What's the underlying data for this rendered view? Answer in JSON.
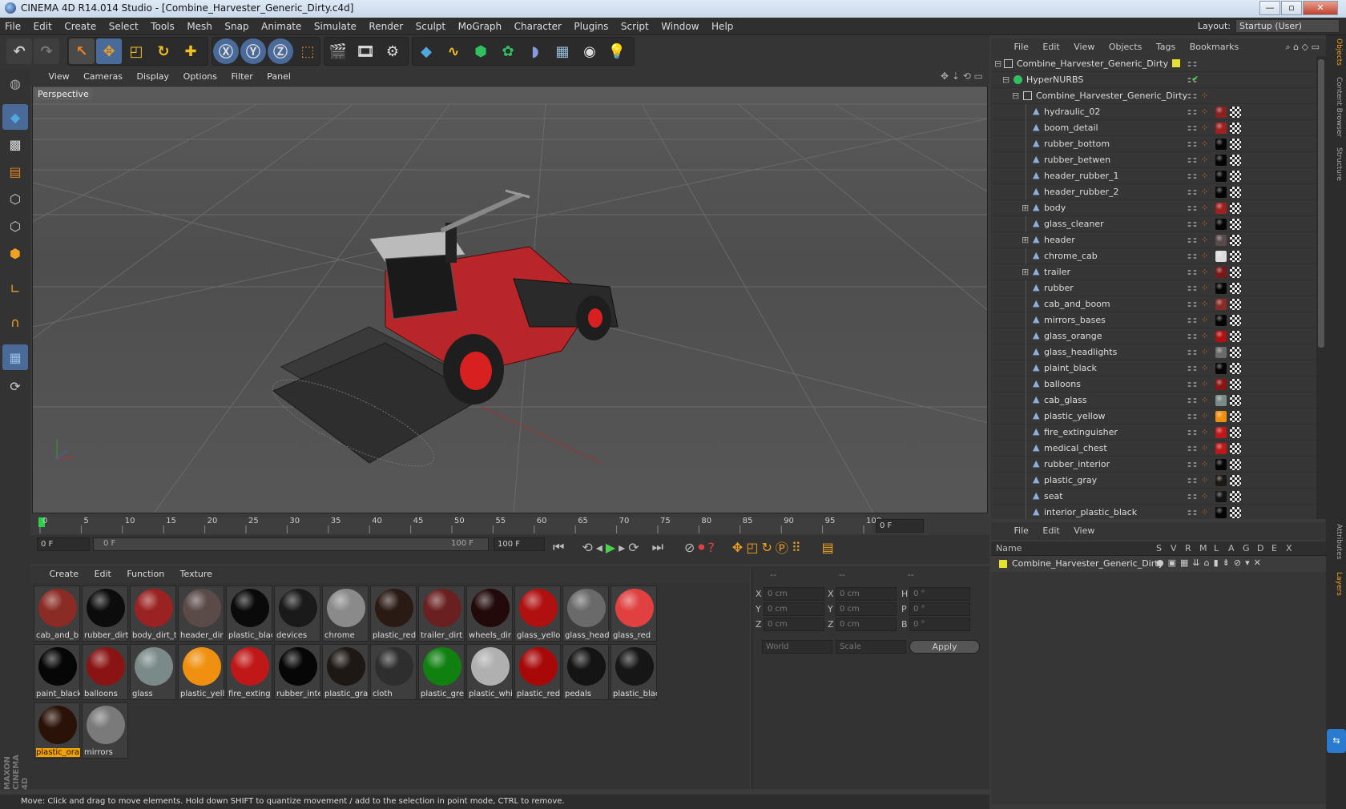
{
  "window": {
    "title": "CINEMA 4D R14.014 Studio - [Combine_Harvester_Generic_Dirty.c4d]",
    "controls": [
      "—",
      "▫",
      "✕"
    ]
  },
  "menubar": [
    "File",
    "Edit",
    "Create",
    "Select",
    "Tools",
    "Mesh",
    "Snap",
    "Animate",
    "Simulate",
    "Render",
    "Sculpt",
    "MoGraph",
    "Character",
    "Plugins",
    "Script",
    "Window",
    "Help"
  ],
  "layout": {
    "label": "Layout:",
    "value": "Startup (User)"
  },
  "viewport": {
    "menu": [
      "View",
      "Cameras",
      "Display",
      "Options",
      "Filter",
      "Panel"
    ],
    "label": "Perspective"
  },
  "timeline": {
    "ticks": [
      "0",
      "5",
      "10",
      "15",
      "20",
      "25",
      "30",
      "35",
      "40",
      "45",
      "50",
      "55",
      "60",
      "65",
      "70",
      "75",
      "80",
      "85",
      "90",
      "95",
      "100"
    ],
    "current_frame": "0 F"
  },
  "anim": {
    "start": "0 F",
    "range_start": "0 F",
    "range_end": "100 F",
    "end": "100 F"
  },
  "materials": {
    "menu": [
      "Create",
      "Edit",
      "Function",
      "Texture"
    ],
    "items": [
      {
        "name": "cab_and_b",
        "color": "#8a2b25"
      },
      {
        "name": "rubber_dirt",
        "color": "#0c0c0c"
      },
      {
        "name": "body_dirt_t",
        "color": "#9a2222"
      },
      {
        "name": "header_dir",
        "color": "#5a4a48"
      },
      {
        "name": "plastic_blac",
        "color": "#0a0a0a"
      },
      {
        "name": "devices",
        "color": "#1a1a1a"
      },
      {
        "name": "chrome",
        "color": "#8a8a8a"
      },
      {
        "name": "plastic_red",
        "color": "#2a1a14"
      },
      {
        "name": "trailer_dirt",
        "color": "#6a2020"
      },
      {
        "name": "wheels_dir",
        "color": "#220a0a"
      },
      {
        "name": "glass_yello",
        "color": "#b01010"
      },
      {
        "name": "glass_head",
        "color": "#6a6a6a"
      },
      {
        "name": "glass_red",
        "color": "#e04040"
      },
      {
        "name": "paint_black",
        "color": "#060606"
      },
      {
        "name": "balloons",
        "color": "#8a1414"
      },
      {
        "name": "glass",
        "color": "#7a8a88"
      },
      {
        "name": "plastic_yell",
        "color": "#f09010"
      },
      {
        "name": "fire_exting",
        "color": "#c01818"
      },
      {
        "name": "rubber_inte",
        "color": "#060606"
      },
      {
        "name": "plastic_gra",
        "color": "#1e1814"
      },
      {
        "name": "cloth",
        "color": "#2e2e2e"
      },
      {
        "name": "plastic_gre",
        "color": "#108010"
      },
      {
        "name": "plastic_whi",
        "color": "#b0b0b0"
      },
      {
        "name": "plastic_red",
        "color": "#a80808"
      },
      {
        "name": "pedals",
        "color": "#141414"
      },
      {
        "name": "plastic_blac",
        "color": "#161616"
      },
      {
        "name": "plastic_ora",
        "color": "#2a1208"
      },
      {
        "name": "mirrors",
        "color": "#7a7a7a"
      }
    ]
  },
  "coords": {
    "headers": [
      "--",
      "--",
      "--"
    ],
    "rows": [
      {
        "a": "X",
        "av": "0 cm",
        "b": "X",
        "bv": "0 cm",
        "c": "H",
        "cv": "0 °"
      },
      {
        "a": "Y",
        "av": "0 cm",
        "b": "Y",
        "bv": "0 cm",
        "c": "P",
        "cv": "0 °"
      },
      {
        "a": "Z",
        "av": "0 cm",
        "b": "Z",
        "bv": "0 cm",
        "c": "B",
        "cv": "0 °"
      }
    ],
    "world": "World",
    "scale": "Scale",
    "apply": "Apply"
  },
  "objects": {
    "menu": [
      "File",
      "Edit",
      "View",
      "Objects",
      "Tags",
      "Bookmarks"
    ],
    "root": "Combine_Harvester_Generic_Dirty",
    "hypernurbs": "HyperNURBS",
    "group": "Combine_Harvester_Generic_Dirty",
    "items": [
      {
        "name": "hydraulic_02",
        "tag": "#8a2020",
        "expand": false
      },
      {
        "name": "boom_detail",
        "tag": "#a02020",
        "expand": false
      },
      {
        "name": "rubber_bottom",
        "tag": "#050505",
        "expand": false
      },
      {
        "name": "rubber_betwen",
        "tag": "#050505",
        "expand": false
      },
      {
        "name": "header_rubber_1",
        "tag": "#050505",
        "expand": false
      },
      {
        "name": "header_rubber_2",
        "tag": "#050505",
        "expand": false
      },
      {
        "name": "body",
        "tag": "#a02020",
        "expand": true
      },
      {
        "name": "glass_cleaner",
        "tag": "#050505",
        "expand": false
      },
      {
        "name": "header",
        "tag": "#5a4a48",
        "expand": true
      },
      {
        "name": "chrome_cab",
        "tag": "#dddddd",
        "expand": false
      },
      {
        "name": "trailer",
        "tag": "#7a1818",
        "expand": true
      },
      {
        "name": "rubber",
        "tag": "#050505",
        "expand": false
      },
      {
        "name": "cab_and_boom",
        "tag": "#8a2b25",
        "expand": false
      },
      {
        "name": "mirrors_bases",
        "tag": "#050505",
        "expand": false
      },
      {
        "name": "glass_orange",
        "tag": "#b01010",
        "expand": false
      },
      {
        "name": "glass_headlights",
        "tag": "#6a6a6a",
        "expand": false
      },
      {
        "name": "plaint_black",
        "tag": "#050505",
        "expand": false
      },
      {
        "name": "balloons",
        "tag": "#8a1414",
        "expand": false
      },
      {
        "name": "cab_glass",
        "tag": "#7a8a88",
        "expand": false
      },
      {
        "name": "plastic_yellow",
        "tag": "#f09010",
        "expand": false
      },
      {
        "name": "fire_extinguisher",
        "tag": "#c01818",
        "expand": false
      },
      {
        "name": "medical_chest",
        "tag": "#c01818",
        "expand": false
      },
      {
        "name": "rubber_interior",
        "tag": "#050505",
        "expand": false
      },
      {
        "name": "plastic_gray",
        "tag": "#1e1814",
        "expand": false
      },
      {
        "name": "seat",
        "tag": "#141414",
        "expand": false
      },
      {
        "name": "interior_plastic_black",
        "tag": "#050505",
        "expand": false
      }
    ]
  },
  "layers": {
    "menu": [
      "File",
      "Edit",
      "View"
    ],
    "columns": [
      "Name",
      "S",
      "V",
      "R",
      "M",
      "L",
      "A",
      "G",
      "D",
      "E",
      "X"
    ],
    "row": "Combine_Harvester_Generic_Dirty"
  },
  "sidetabs": [
    "Objects",
    "Content Browser",
    "Structure",
    "Attributes",
    "Layers"
  ],
  "status": "Move: Click and drag to move elements. Hold down SHIFT to quantize movement / add to the selection in point mode, CTRL to remove."
}
